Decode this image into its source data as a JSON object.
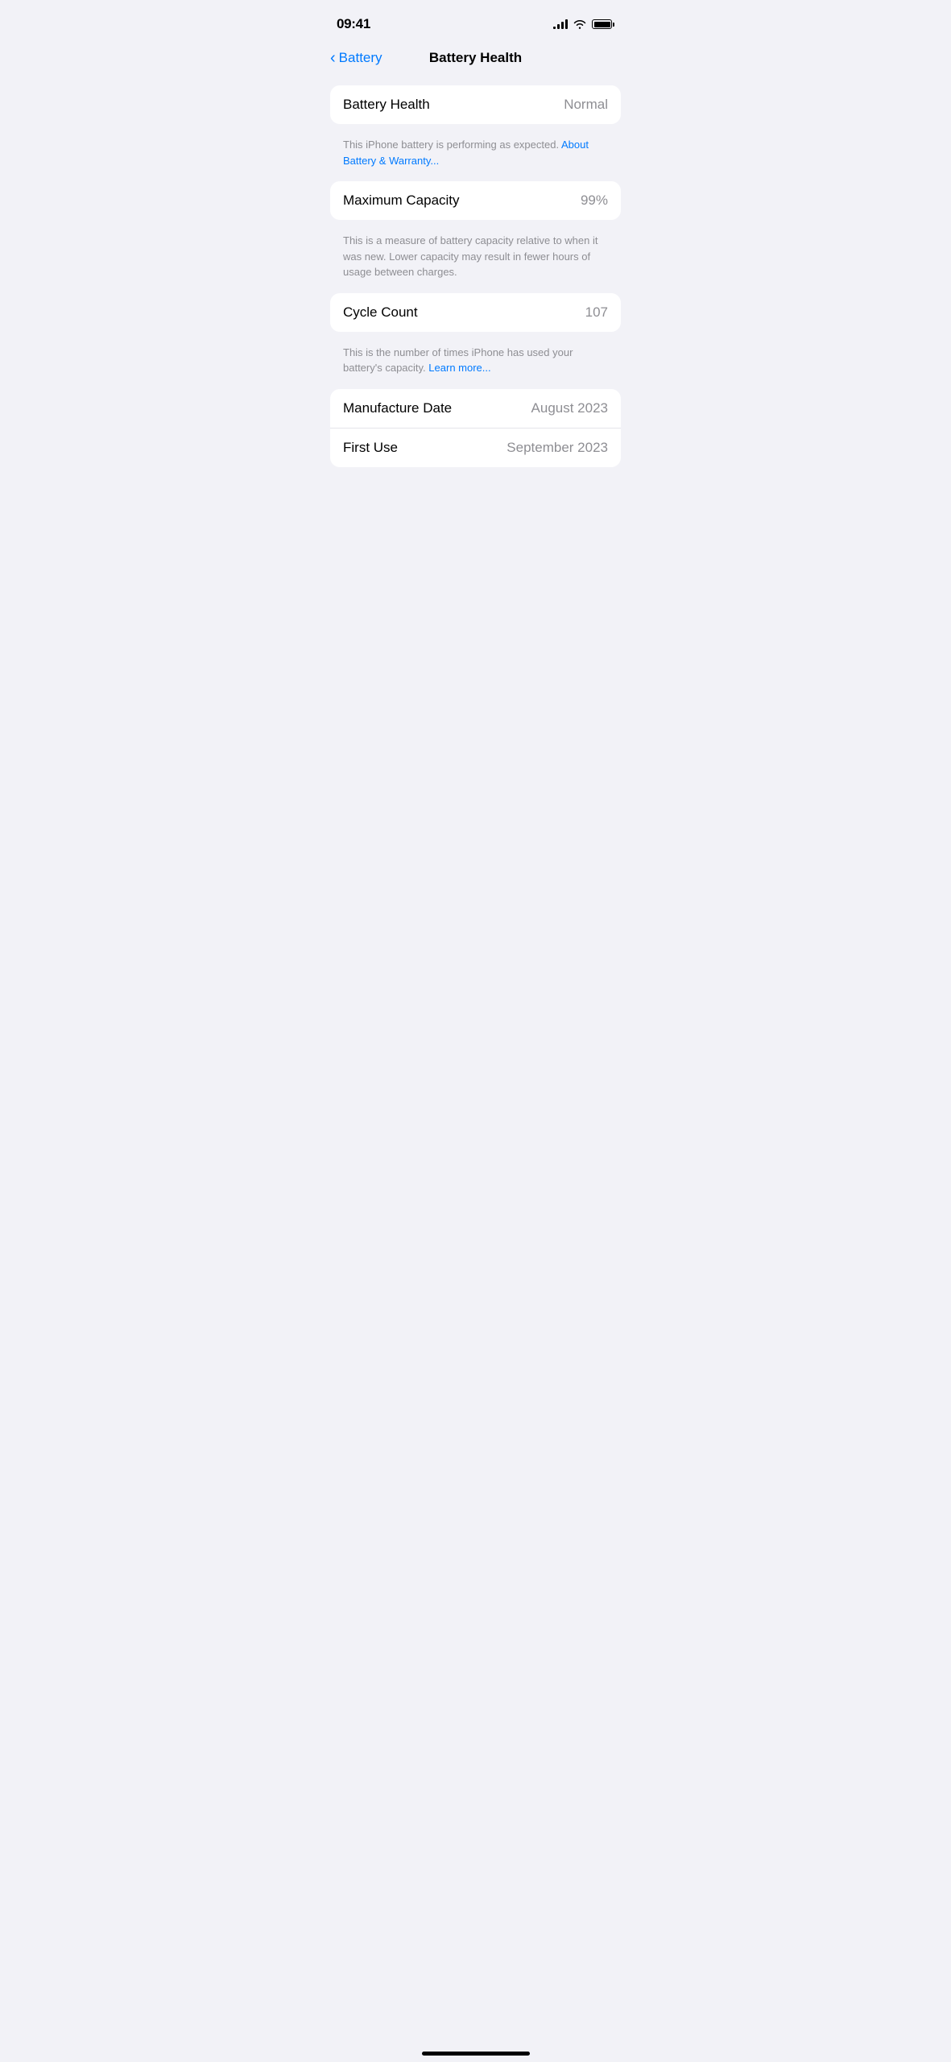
{
  "statusBar": {
    "time": "09:41",
    "battery": "full"
  },
  "nav": {
    "backLabel": "Battery",
    "pageTitle": "Battery Health"
  },
  "sections": [
    {
      "id": "battery-health-section",
      "rows": [
        {
          "label": "Battery Health",
          "value": "Normal"
        }
      ],
      "description": "This iPhone battery is performing as expected.",
      "linkText": " About Battery & Warranty...",
      "hasLink": true
    },
    {
      "id": "maximum-capacity-section",
      "rows": [
        {
          "label": "Maximum Capacity",
          "value": "99%"
        }
      ],
      "description": "This is a measure of battery capacity relative to when it was new. Lower capacity may result in fewer hours of usage between charges.",
      "hasLink": false
    },
    {
      "id": "cycle-count-section",
      "rows": [
        {
          "label": "Cycle Count",
          "value": "107"
        }
      ],
      "description": "This is the number of times iPhone has used your battery's capacity.",
      "linkText": " Learn more...",
      "hasLink": true
    },
    {
      "id": "dates-section",
      "rows": [
        {
          "label": "Manufacture Date",
          "value": "August 2023"
        },
        {
          "label": "First Use",
          "value": "September 2023"
        }
      ],
      "hasLink": false
    }
  ]
}
